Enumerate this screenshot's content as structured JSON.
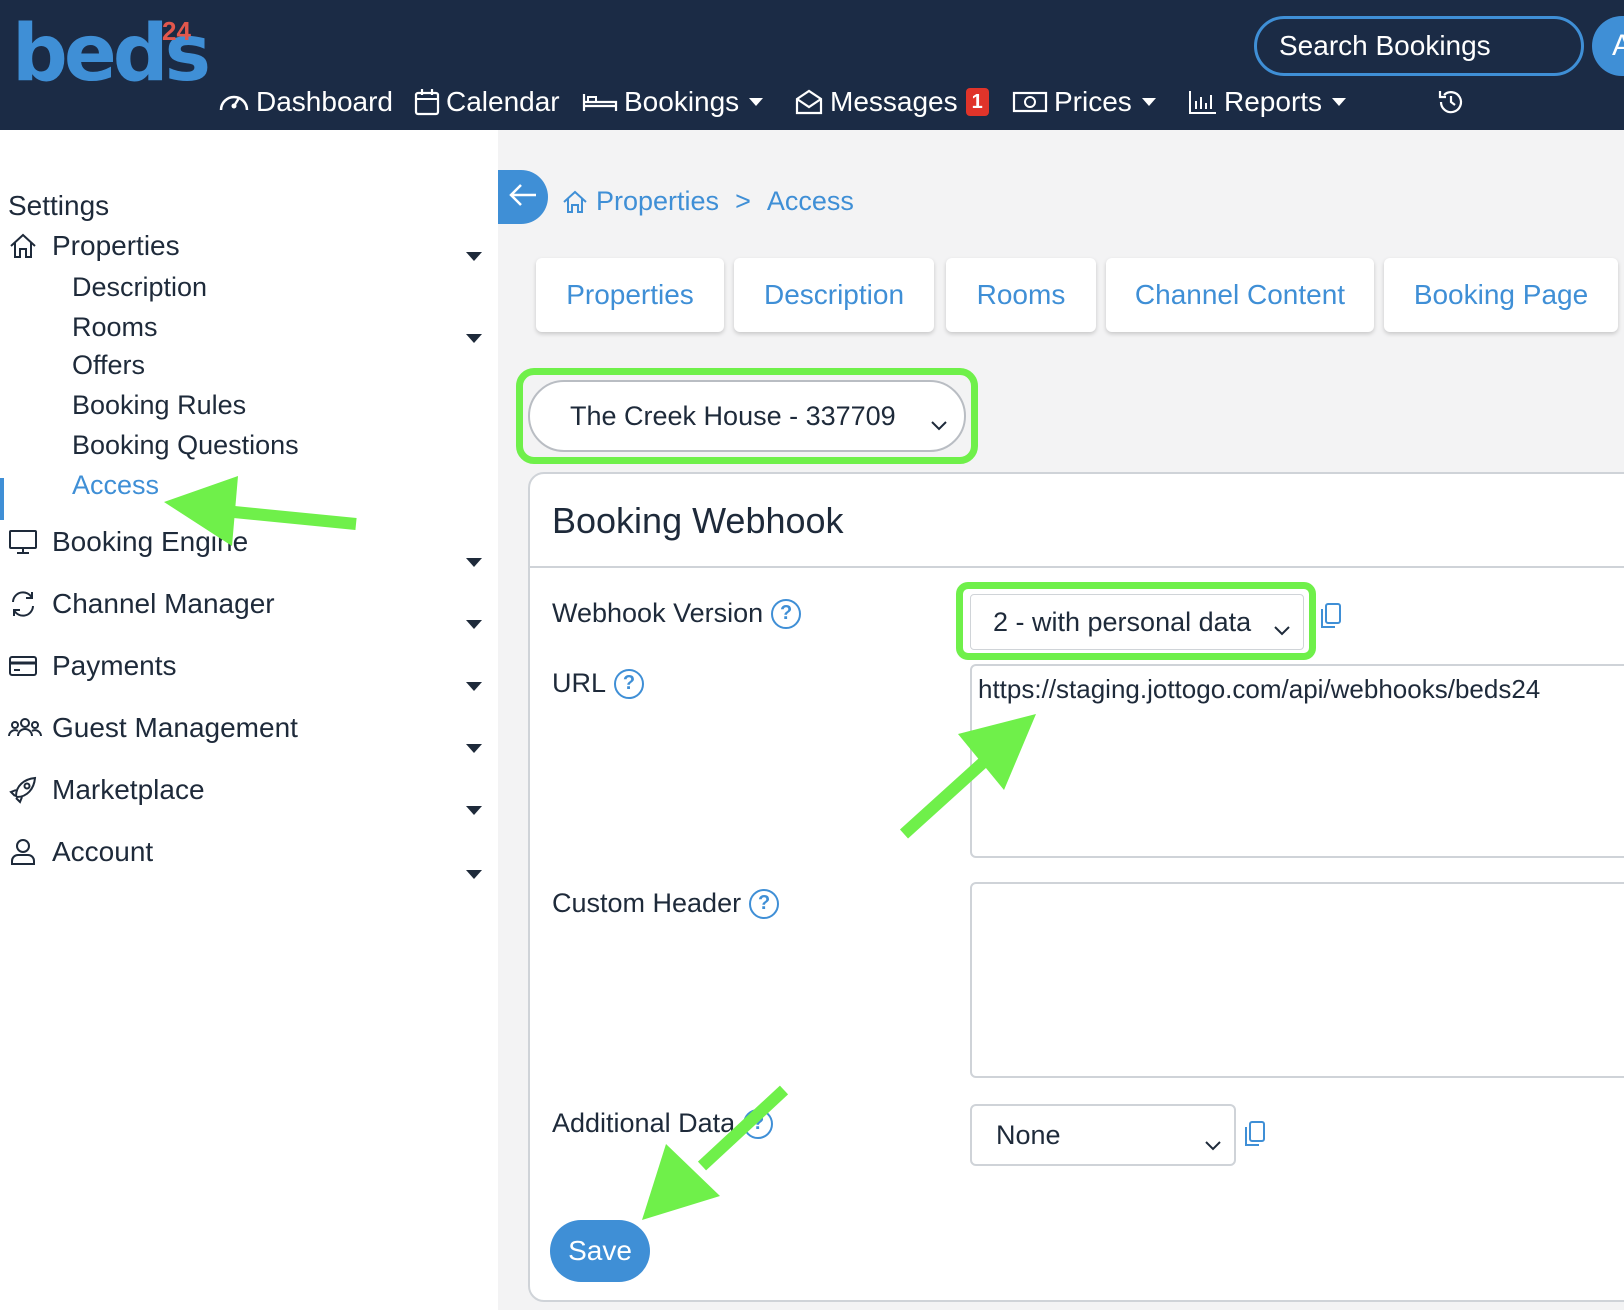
{
  "app": {
    "logo_text": "beds",
    "logo_number": "24"
  },
  "header": {
    "search_label": "Search Bookings",
    "avatar_initial": "A",
    "nav": [
      {
        "label": "Dashboard",
        "icon": "dashboard-icon"
      },
      {
        "label": "Calendar",
        "icon": "calendar-icon"
      },
      {
        "label": "Bookings",
        "icon": "bed-icon",
        "dropdown": true
      },
      {
        "label": "Messages",
        "icon": "envelope-icon",
        "badge": "1"
      },
      {
        "label": "Prices",
        "icon": "money-icon",
        "dropdown": true
      },
      {
        "label": "Reports",
        "icon": "chart-icon",
        "dropdown": true
      }
    ]
  },
  "sidebar": {
    "title": "Settings",
    "properties": {
      "label": "Properties",
      "icon": "home-icon"
    },
    "sub_items": [
      "Description",
      "Rooms",
      "Offers",
      "Booking Rules",
      "Booking Questions",
      "Access"
    ],
    "active_sub": "Access",
    "sections": [
      {
        "label": "Booking Engine",
        "icon": "monitor-icon"
      },
      {
        "label": "Channel Manager",
        "icon": "sync-icon"
      },
      {
        "label": "Payments",
        "icon": "credit-card-icon"
      },
      {
        "label": "Guest Management",
        "icon": "people-icon"
      },
      {
        "label": "Marketplace",
        "icon": "rocket-icon"
      },
      {
        "label": "Account",
        "icon": "user-icon"
      }
    ]
  },
  "breadcrumb": {
    "home": "Properties",
    "separator": ">",
    "current": "Access"
  },
  "tabs": [
    "Properties",
    "Description",
    "Rooms",
    "Channel Content",
    "Booking Page"
  ],
  "property_select": {
    "value": "The Creek House - 337709"
  },
  "webhook_card": {
    "title": "Booking Webhook",
    "version_label": "Webhook Version",
    "version_value": "2 - with personal data",
    "url_label": "URL",
    "url_value": "https://staging.jottogo.com/api/webhooks/beds24",
    "custom_header_label": "Custom Header",
    "custom_header_value": "",
    "additional_data_label": "Additional Data",
    "additional_data_value": "None",
    "help_glyph": "?",
    "save_label": "Save"
  },
  "colors": {
    "topbar": "#1b2b45",
    "accent": "#3f8fd6",
    "highlight": "#6ff04a",
    "badge": "#e0342a"
  }
}
